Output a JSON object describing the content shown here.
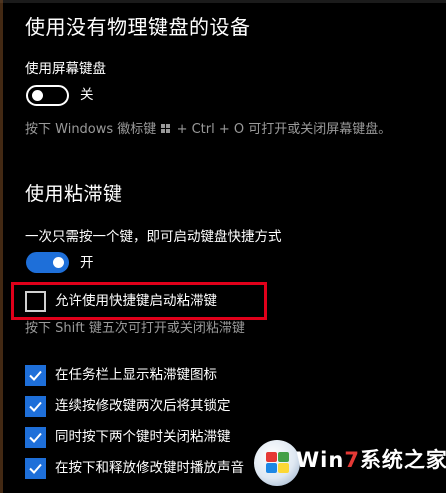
{
  "section1": {
    "title": "使用没有物理键盘的设备",
    "onscreen_label": "使用屏幕键盘",
    "onscreen_toggle_state": "关",
    "hint_prefix": "按下 Windows 徽标键",
    "hint_suffix": "+ Ctrl + O 可打开或关闭屏幕键盘。"
  },
  "section2": {
    "title": "使用粘滞键",
    "desc": "一次只需按一个键，即可启动键盘快捷方式",
    "toggle_state": "开",
    "shortcut_checkbox": {
      "label": "允许使用快捷键启动粘滞键",
      "checked": false
    },
    "shortcut_hint": "按下 Shift 键五次可打开或关闭粘滞键",
    "options": [
      {
        "label": "在任务栏上显示粘滞键图标",
        "checked": true
      },
      {
        "label": "连续按修改键两次后将其锁定",
        "checked": true
      },
      {
        "label": "同时按下两个键时关闭粘滞键",
        "checked": true
      },
      {
        "label": "在按下和释放修改键时播放声音",
        "checked": true
      }
    ]
  },
  "colors": {
    "accent": "#1e6fd9",
    "highlight": "#e0001a",
    "hint": "#9a9a9a",
    "background": "#000000"
  },
  "watermark": {
    "text_prefix": "Win",
    "text_seven": "7",
    "text_suffix": "系统之家"
  }
}
